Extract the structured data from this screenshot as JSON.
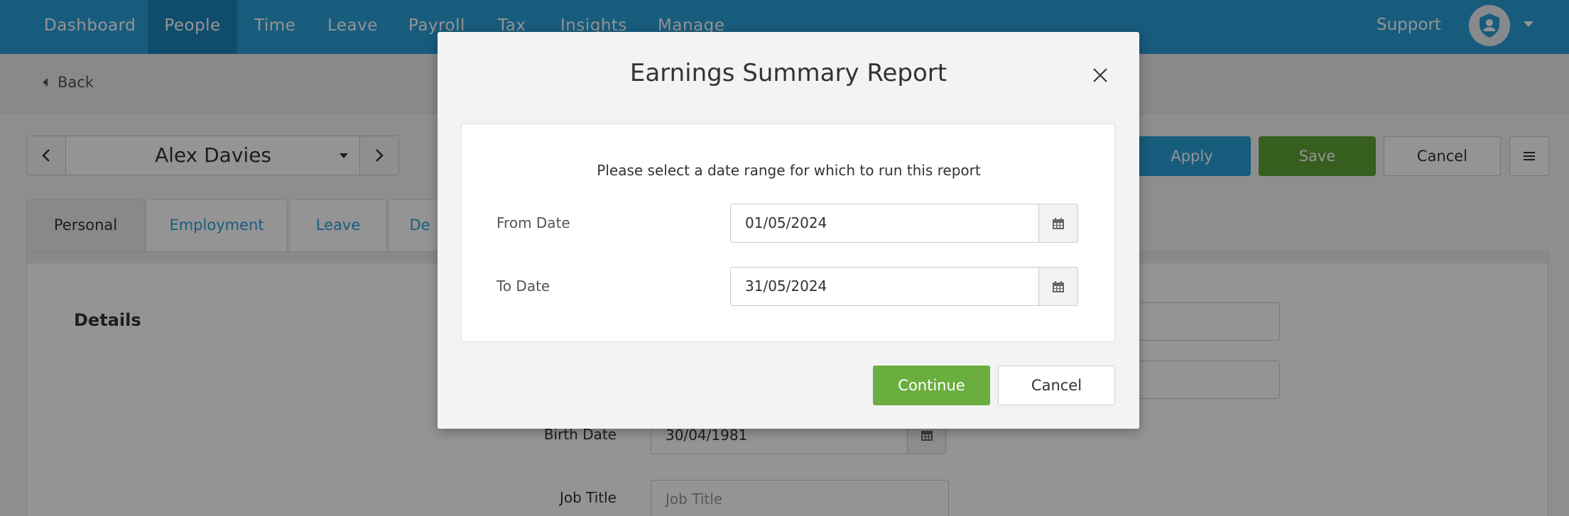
{
  "nav": {
    "items": [
      {
        "label": "Dashboard"
      },
      {
        "label": "People"
      },
      {
        "label": "Time"
      },
      {
        "label": "Leave"
      },
      {
        "label": "Payroll"
      },
      {
        "label": "Tax"
      },
      {
        "label": "Insights"
      },
      {
        "label": "Manage"
      }
    ],
    "active": "People",
    "support_label": "Support",
    "avatar_icon": "shield-user-icon",
    "brand_color": "#2a9fd8"
  },
  "backbar": {
    "back_label": "Back"
  },
  "employee_selector": {
    "name": "Alex Davies"
  },
  "actions": {
    "apply_label": "Apply",
    "save_label": "Save",
    "cancel_label": "Cancel",
    "menu_icon": "hamburger-icon"
  },
  "tabs": [
    {
      "label": "Personal"
    },
    {
      "label": "Employment"
    },
    {
      "label": "Leave"
    },
    {
      "label": "De"
    }
  ],
  "details": {
    "title": "Details",
    "birth_date_label": "Birth Date",
    "birth_date_value": "30/04/1981",
    "job_title_label": "Job Title",
    "job_title_placeholder": "Job Title"
  },
  "modal": {
    "title": "Earnings Summary Report",
    "message": "Please select a date range for which to run this report",
    "from_label": "From Date",
    "from_value": "01/05/2024",
    "to_label": "To Date",
    "to_value": "31/05/2024",
    "continue_label": "Continue",
    "cancel_label": "Cancel",
    "continue_color": "#6aae3f"
  }
}
